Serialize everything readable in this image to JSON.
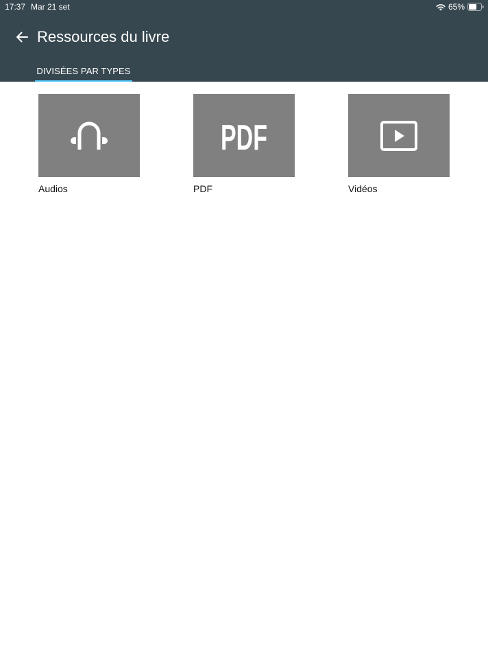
{
  "status_bar": {
    "time": "17:37",
    "date": "Mar 21 set",
    "battery": "65%",
    "battery_level": 0.65,
    "icons": [
      "wifi-icon",
      "battery-icon"
    ]
  },
  "header": {
    "back_icon": "arrow-left-icon",
    "title": "Ressources du livre",
    "background_color": "#37474f"
  },
  "tabs": [
    {
      "label": "DIVISÉES PAR TYPES",
      "selected": true,
      "indicator_color": "#4fc3f7"
    }
  ],
  "resources": [
    {
      "label": "Audios",
      "icon": "headphones-icon"
    },
    {
      "label": "PDF",
      "icon": "pdf-icon",
      "icon_text": "PDF"
    },
    {
      "label": "Vidéos",
      "icon": "video-play-icon"
    }
  ],
  "tile_color": "#808080"
}
